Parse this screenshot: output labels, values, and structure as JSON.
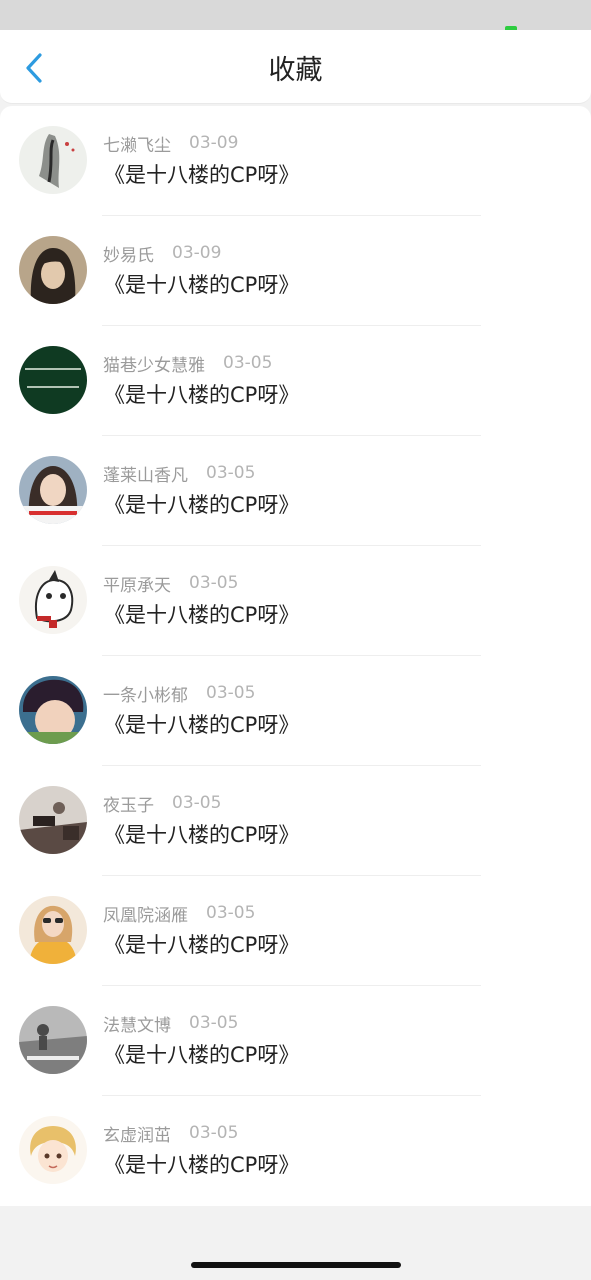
{
  "header": {
    "title": "收藏",
    "back_icon": "chevron-left-icon",
    "accent_color": "#2d9be0"
  },
  "items": [
    {
      "name": "七濑飞尘",
      "date": "03-09",
      "subject": "《是十八楼的CP呀》",
      "avatar": "ink-painting"
    },
    {
      "name": "妙易氏",
      "date": "03-09",
      "subject": "《是十八楼的CP呀》",
      "avatar": "portrait-dark-hair"
    },
    {
      "name": "猫巷少女慧雅",
      "date": "03-05",
      "subject": "《是十八楼的CP呀》",
      "avatar": "green-text-card"
    },
    {
      "name": "蓬莱山香凡",
      "date": "03-05",
      "subject": "《是十八楼的CP呀》",
      "avatar": "girl-with-caption"
    },
    {
      "name": "平原承天",
      "date": "03-05",
      "subject": "《是十八楼的CP呀》",
      "avatar": "cartoon-cat"
    },
    {
      "name": "一条小彬郁",
      "date": "03-05",
      "subject": "《是十八楼的CP呀》",
      "avatar": "child-portrait"
    },
    {
      "name": "夜玉子",
      "date": "03-05",
      "subject": "《是十八楼的CP呀》",
      "avatar": "vintage-scene"
    },
    {
      "name": "凤凰院涵雁",
      "date": "03-05",
      "subject": "《是十八楼的CP呀》",
      "avatar": "girl-yellow-sweater"
    },
    {
      "name": "法慧文博",
      "date": "03-05",
      "subject": "《是十八楼的CP呀》",
      "avatar": "grey-landscape"
    },
    {
      "name": "玄虚润茁",
      "date": "03-05",
      "subject": "《是十八楼的CP呀》",
      "avatar": "anime-character"
    }
  ]
}
